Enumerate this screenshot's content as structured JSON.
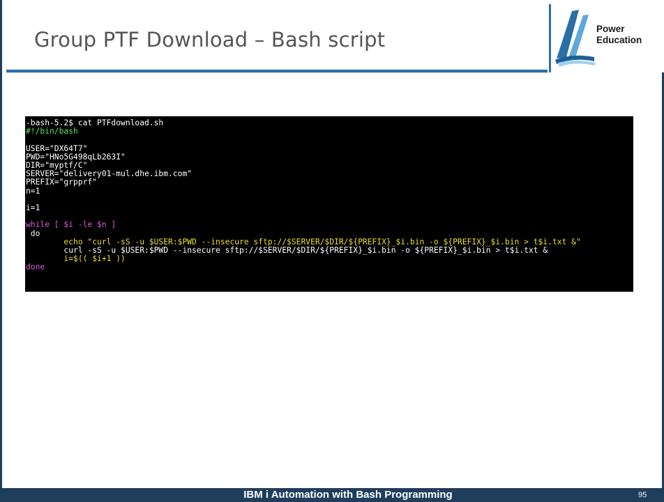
{
  "slide": {
    "title": "Group PTF Download – Bash script",
    "stray_glyph": "0"
  },
  "logo": {
    "line1": "Power",
    "line2": "Education",
    "colors": [
      "#2a6fa8",
      "#5fa8dc",
      "#9fd0ef"
    ]
  },
  "terminal": {
    "background": "#000000",
    "lines": [
      "-bash-5.2$ cat PTFdownload.sh",
      "#!/bin/bash",
      "",
      "USER=\"DX64T7\"",
      "PWD=\"HNo5G498qLb263I\"",
      "DIR=\"myptf/C\"",
      "SERVER=\"delivery01-mul.dhe.ibm.com\"",
      "PREFIX=\"grpprf\"",
      "n=1",
      "",
      "i=1",
      "",
      "while [ $i -le $n ]",
      " do",
      "        echo \"curl -sS -u $USER:$PWD --insecure sftp://$SERVER/$DIR/${PREFIX}_$i.bin -o ${PREFIX}_$i.bin > t$i.txt &\"",
      "        curl -sS -u $USER:$PWD --insecure sftp://$SERVER/$DIR/${PREFIX}_$i.bin -o ${PREFIX}_$i.bin > t$i.txt &",
      "        i=$(( $i+1 ))",
      "done"
    ]
  },
  "footer": {
    "title": "IBM i Automation with Bash Programming",
    "page_number": "95",
    "background": "#1f3e5c"
  }
}
